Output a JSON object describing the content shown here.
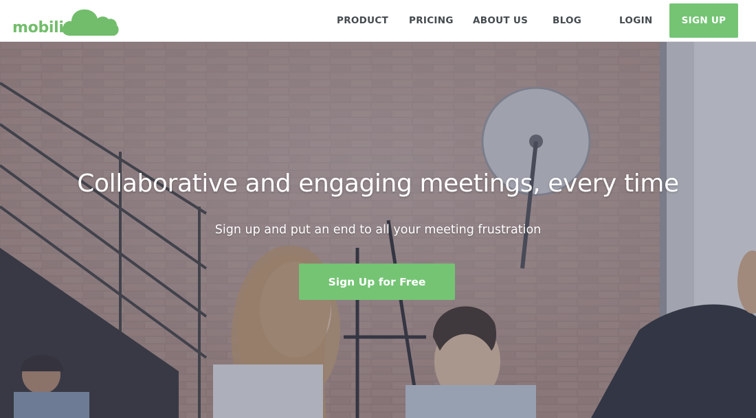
{
  "brand": {
    "name": "mobilimeet",
    "color": "#72bd6b",
    "logo_icon": "cloud-icon"
  },
  "nav": {
    "items": [
      {
        "label": "PRODUCT"
      },
      {
        "label": "PRICING"
      },
      {
        "label": "ABOUT US"
      },
      {
        "label": "BLOG"
      },
      {
        "label": "LOGIN"
      }
    ],
    "signup_label": "SIGN UP",
    "accent": "#74c474",
    "text_color": "#444a4e"
  },
  "hero": {
    "title": "Collaborative and engaging meetings, every time",
    "subtitle": "Sign up and put an end to all your meeting frustration",
    "cta_label": "Sign Up for Free",
    "background_description_icon": "office-meeting-photo"
  }
}
